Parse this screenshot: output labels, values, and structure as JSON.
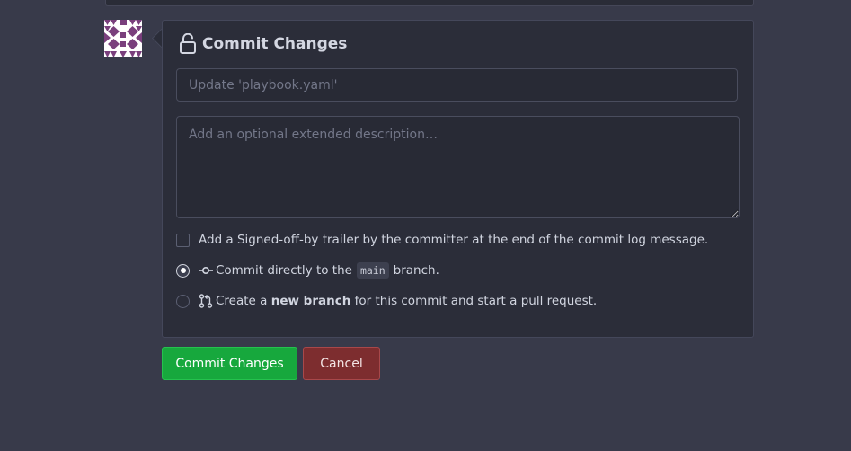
{
  "commit_form": {
    "title": "Commit Changes",
    "summary_placeholder": "Update 'playbook.yaml'",
    "description_placeholder": "Add an optional extended description…",
    "signoff_label": "Add a Signed-off-by trailer by the committer at the end of the commit log message.",
    "options": {
      "direct": {
        "prefix": "Commit directly to the",
        "branch": "main",
        "suffix": "branch.",
        "selected": true
      },
      "new_branch": {
        "prefix": "Create a",
        "bold": "new branch",
        "suffix": "for this commit and start a pull request.",
        "selected": false
      }
    }
  },
  "buttons": {
    "commit": "Commit Changes",
    "cancel": "Cancel"
  },
  "icons": {
    "header": "unlock-icon",
    "direct": "git-commit-icon",
    "new_branch": "git-pull-request-icon"
  },
  "colors": {
    "background": "#383a4a",
    "panel": "#2b2d39",
    "commit_button": "#17a83d",
    "cancel_button": "#7d2d2f",
    "avatar": "#7a3f7d"
  }
}
